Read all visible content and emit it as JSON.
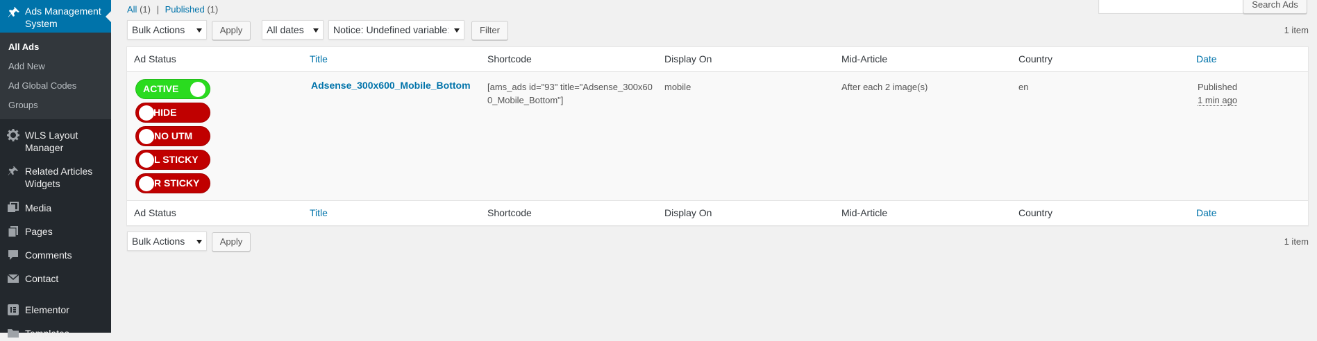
{
  "sidebar": {
    "current": {
      "label": "Ads Management System",
      "icon": "pin-icon"
    },
    "submenu": [
      "All Ads",
      "Add New",
      "Ad Global Codes",
      "Groups"
    ],
    "items": [
      {
        "label": "WLS Layout Manager",
        "icon": "gear-icon"
      },
      {
        "label": "Related Articles Widgets",
        "icon": "pin-icon"
      },
      {
        "label": "Media",
        "icon": "media-icon"
      },
      {
        "label": "Pages",
        "icon": "pages-icon"
      },
      {
        "label": "Comments",
        "icon": "comment-icon"
      },
      {
        "label": "Contact",
        "icon": "mail-icon"
      },
      {
        "label": "Elementor",
        "icon": "elementor-icon"
      },
      {
        "label": "Templates",
        "icon": "folder-icon"
      }
    ]
  },
  "views": {
    "all": "All",
    "all_count": "(1)",
    "separator": "|",
    "published": "Published",
    "published_count": "(1)"
  },
  "search": {
    "placeholder": "",
    "button": "Search Ads"
  },
  "top_nav": {
    "bulk_actions": "Bulk Actions",
    "apply": "Apply",
    "dates": "All dates",
    "notice_select": "Notice: Undefined variable: ",
    "filter": "Filter",
    "items_count": "1 item"
  },
  "columns": [
    "Ad Status",
    "Title",
    "Shortcode",
    "Display On",
    "Mid-Article",
    "Country",
    "Date"
  ],
  "row": {
    "toggles": [
      {
        "label": "ACTIVE",
        "state": "on"
      },
      {
        "label": "HIDE",
        "state": "off"
      },
      {
        "label": "NO UTM",
        "state": "off"
      },
      {
        "label": "L STICKY",
        "state": "off"
      },
      {
        "label": "R STICKY",
        "state": "off"
      }
    ],
    "title": "Adsense_300x600_Mobile_Bottom",
    "shortcode": "[ams_ads id=\"93\" title=\"Adsense_300x600_Mobile_Bottom\"]",
    "display_on": "mobile",
    "mid_article": "After each 2 image(s)",
    "country": "en",
    "date_status": "Published",
    "date_ago": "1 min ago"
  },
  "bottom_nav": {
    "bulk_actions": "Bulk Actions",
    "apply": "Apply",
    "items_count": "1 item"
  },
  "colors": {
    "sidebar_bg": "#23282d",
    "accent": "#0073aa",
    "toggle_on": "#2adb1f",
    "toggle_off": "#c00000"
  }
}
